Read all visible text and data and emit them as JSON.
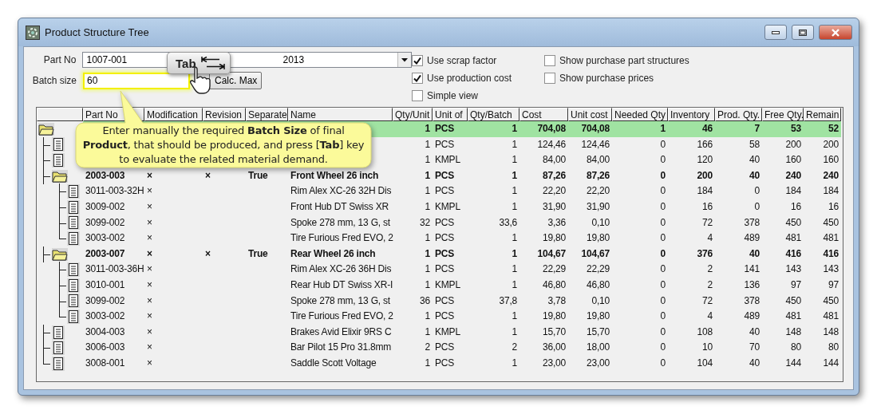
{
  "window": {
    "title": "Product Structure Tree"
  },
  "form": {
    "part_no": {
      "label": "Part No",
      "value": "1007-001",
      "extra": "2013"
    },
    "batch_size": {
      "label": "Batch size",
      "value": "60",
      "highlighted": true
    },
    "calc_button": "Calc. Max"
  },
  "options": [
    {
      "label": "Use scrap factor",
      "checked": true
    },
    {
      "label": "Use production cost",
      "checked": true
    },
    {
      "label": "Simple view",
      "checked": false
    },
    {
      "label": "Show purchase part structures",
      "checked": false
    },
    {
      "label": "Show purchase prices",
      "checked": false
    }
  ],
  "table": {
    "columns": [
      "Part No",
      "Modification",
      "Revision",
      "Separate",
      "Name",
      "Qty/Unit",
      "Unit of",
      "Qty/Batch",
      "Cost",
      "Unit cost",
      "Needed Qty",
      "Inventory",
      "Prod. Qty.",
      "Free Qty.",
      "Remain"
    ],
    "rows": [
      {
        "kind": "assembly",
        "selected": true,
        "qty_unit": "1",
        "unit": "PCS",
        "qty_batch": "1",
        "cost": "704,08",
        "unit_cost": "704,08",
        "needed_qty": "1",
        "inventory": "46",
        "prod_qty": "7",
        "free_qty": "53",
        "remain": "52",
        "children": [
          {
            "kind": "part",
            "selected": false,
            "qty_unit": "1",
            "unit": "PCS",
            "qty_batch": "1",
            "cost": "124,46",
            "unit_cost": "124,46",
            "needed_qty": "0",
            "inventory": "166",
            "prod_qty": "58",
            "free_qty": "200",
            "remain": "200"
          },
          {
            "kind": "part",
            "selected": false,
            "qty_unit": "1",
            "unit": "KMPL",
            "qty_batch": "1",
            "cost": "84,00",
            "unit_cost": "84,00",
            "needed_qty": "0",
            "inventory": "120",
            "prod_qty": "40",
            "free_qty": "160",
            "remain": "160"
          },
          {
            "kind": "assembly",
            "selected": false,
            "part_no": "2003-003",
            "modification": "×",
            "revision": "×",
            "separate": "True",
            "name": "Front Wheel 26 inch",
            "qty_unit": "1",
            "unit": "PCS",
            "qty_batch": "1",
            "cost": "87,26",
            "unit_cost": "87,26",
            "needed_qty": "0",
            "inventory": "200",
            "prod_qty": "40",
            "free_qty": "240",
            "remain": "240",
            "children": [
              {
                "kind": "part",
                "selected": false,
                "part_no": "3011-003-32H",
                "modification": "×",
                "name": "Rim Alex XC-26 32H Dis",
                "qty_unit": "1",
                "unit": "PCS",
                "qty_batch": "1",
                "cost": "22,20",
                "unit_cost": "22,20",
                "needed_qty": "0",
                "inventory": "184",
                "prod_qty": "0",
                "free_qty": "184",
                "remain": "184"
              },
              {
                "kind": "part",
                "selected": false,
                "part_no": "3009-002",
                "modification": "×",
                "name": "Front Hub DT Swiss XR",
                "qty_unit": "1",
                "unit": "KMPL",
                "qty_batch": "1",
                "cost": "31,90",
                "unit_cost": "31,90",
                "needed_qty": "0",
                "inventory": "16",
                "prod_qty": "0",
                "free_qty": "16",
                "remain": "16"
              },
              {
                "kind": "part",
                "selected": false,
                "part_no": "3099-002",
                "modification": "×",
                "name": "Spoke 278 mm, 13 G, st",
                "qty_unit": "32",
                "unit": "PCS",
                "qty_batch": "33,6",
                "cost": "3,36",
                "unit_cost": "0,10",
                "needed_qty": "0",
                "inventory": "72",
                "prod_qty": "378",
                "free_qty": "450",
                "remain": "450"
              },
              {
                "kind": "part",
                "selected": false,
                "part_no": "3003-002",
                "modification": "×",
                "name": "Tire Furious Fred EVO, 2",
                "qty_unit": "1",
                "unit": "PCS",
                "qty_batch": "1",
                "cost": "19,80",
                "unit_cost": "19,80",
                "needed_qty": "0",
                "inventory": "4",
                "prod_qty": "489",
                "free_qty": "481",
                "remain": "481"
              }
            ]
          },
          {
            "kind": "assembly",
            "selected": false,
            "part_no": "2003-007",
            "modification": "×",
            "revision": "×",
            "separate": "True",
            "name": "Rear Wheel 26 inch",
            "qty_unit": "1",
            "unit": "PCS",
            "qty_batch": "1",
            "cost": "104,67",
            "unit_cost": "104,67",
            "needed_qty": "0",
            "inventory": "376",
            "prod_qty": "40",
            "free_qty": "416",
            "remain": "416",
            "children": [
              {
                "kind": "part",
                "selected": false,
                "part_no": "3011-003-36H",
                "modification": "×",
                "name": "Rim Alex XC-26 36H Dis",
                "qty_unit": "1",
                "unit": "PCS",
                "qty_batch": "1",
                "cost": "22,29",
                "unit_cost": "22,29",
                "needed_qty": "0",
                "inventory": "2",
                "prod_qty": "141",
                "free_qty": "143",
                "remain": "143"
              },
              {
                "kind": "part",
                "selected": false,
                "part_no": "3010-001",
                "modification": "×",
                "name": "Rear Hub DT Swiss XR-I",
                "qty_unit": "1",
                "unit": "KMPL",
                "qty_batch": "1",
                "cost": "46,80",
                "unit_cost": "46,80",
                "needed_qty": "0",
                "inventory": "2",
                "prod_qty": "136",
                "free_qty": "97",
                "remain": "97"
              },
              {
                "kind": "part",
                "selected": false,
                "part_no": "3099-002",
                "modification": "×",
                "name": "Spoke 278 mm, 13 G, st",
                "qty_unit": "36",
                "unit": "PCS",
                "qty_batch": "37,8",
                "cost": "3,78",
                "unit_cost": "0,10",
                "needed_qty": "0",
                "inventory": "72",
                "prod_qty": "378",
                "free_qty": "450",
                "remain": "450"
              },
              {
                "kind": "part",
                "selected": false,
                "part_no": "3003-002",
                "modification": "×",
                "name": "Tire Furious Fred EVO, 2",
                "qty_unit": "1",
                "unit": "PCS",
                "qty_batch": "1",
                "cost": "19,80",
                "unit_cost": "19,80",
                "needed_qty": "0",
                "inventory": "4",
                "prod_qty": "489",
                "free_qty": "481",
                "remain": "481"
              }
            ]
          },
          {
            "kind": "part",
            "selected": false,
            "part_no": "3004-003",
            "modification": "×",
            "name": "Brakes Avid Elixir 9RS C",
            "qty_unit": "1",
            "unit": "KMPL",
            "qty_batch": "1",
            "cost": "15,70",
            "unit_cost": "15,70",
            "needed_qty": "0",
            "inventory": "108",
            "prod_qty": "40",
            "free_qty": "148",
            "remain": "148"
          },
          {
            "kind": "part",
            "selected": false,
            "part_no": "3006-003",
            "modification": "×",
            "name": "Bar Pilot 15 Pro 31.8mm",
            "qty_unit": "2",
            "unit": "PCS",
            "qty_batch": "2",
            "cost": "36,00",
            "unit_cost": "18,00",
            "needed_qty": "0",
            "inventory": "10",
            "prod_qty": "70",
            "free_qty": "80",
            "remain": "80"
          },
          {
            "kind": "part",
            "selected": false,
            "part_no": "3008-001",
            "modification": "×",
            "name": "Saddle Scott Voltage",
            "qty_unit": "1",
            "unit": "PCS",
            "qty_batch": "1",
            "cost": "23,00",
            "unit_cost": "23,00",
            "needed_qty": "0",
            "inventory": "104",
            "prod_qty": "40",
            "free_qty": "144",
            "remain": "144"
          }
        ]
      }
    ]
  },
  "callout": {
    "text": "Enter manually the required **Batch Size** of final **Product**, that should be produced, and press [**Tab**] key to evaluate the related material demand."
  },
  "key_hint": {
    "label": "Tab"
  }
}
